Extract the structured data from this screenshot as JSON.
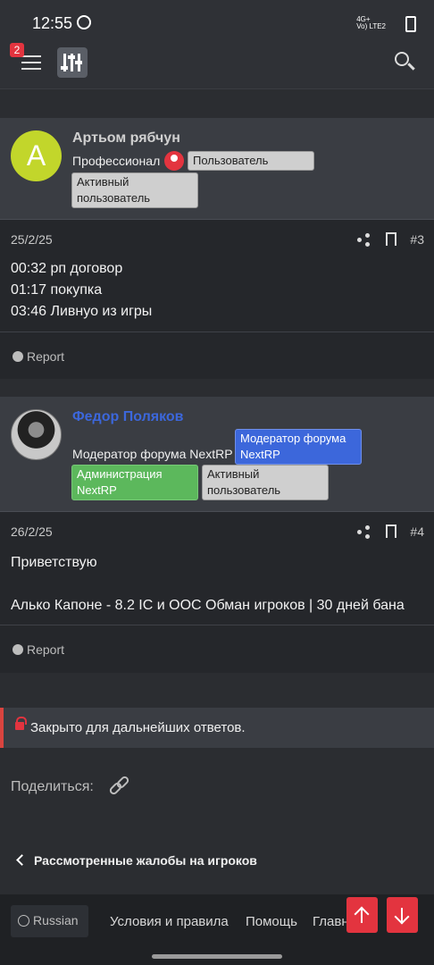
{
  "status_bar": {
    "time": "12:55",
    "network_1": "4G+",
    "network_2": "Vo) LTE2"
  },
  "topbar": {
    "notifications_badge": "2"
  },
  "posts": [
    {
      "author": "Артьом рябчун",
      "avatar_letter": "A",
      "user_title": "Профессионал",
      "tags": [
        "Пользователь",
        "Активный пользователь"
      ],
      "date": "25/2/25",
      "number": "#3",
      "lines": [
        "00:32 рп договор",
        "01:17 покупка",
        "03:46 Ливнуо из игры"
      ],
      "report": "Report",
      "author_color": "#d0d0d0",
      "avatar_color": "#c2d62b"
    },
    {
      "author": "Федор Поляков",
      "user_title": "Модератор форума NextRP",
      "tags": [
        "Модератор форума NextRP",
        "Администрация NextRP",
        "Активный пользователь"
      ],
      "date": "26/2/25",
      "number": "#4",
      "lines": [
        "Приветствую",
        "",
        "Алько Капоне - 8.2 IC и OOC Обман игроков | 30 дней бана"
      ],
      "report": "Report",
      "author_color": "#3c67db"
    }
  ],
  "closed_notice": "Закрыто для дальнейших ответов.",
  "share_label": "Поделиться:",
  "back_link": "Рассмотренные жалобы на игроков",
  "footer": {
    "language": "Russian",
    "links": [
      "Условия и правила",
      "Помощь",
      "Главн"
    ]
  }
}
